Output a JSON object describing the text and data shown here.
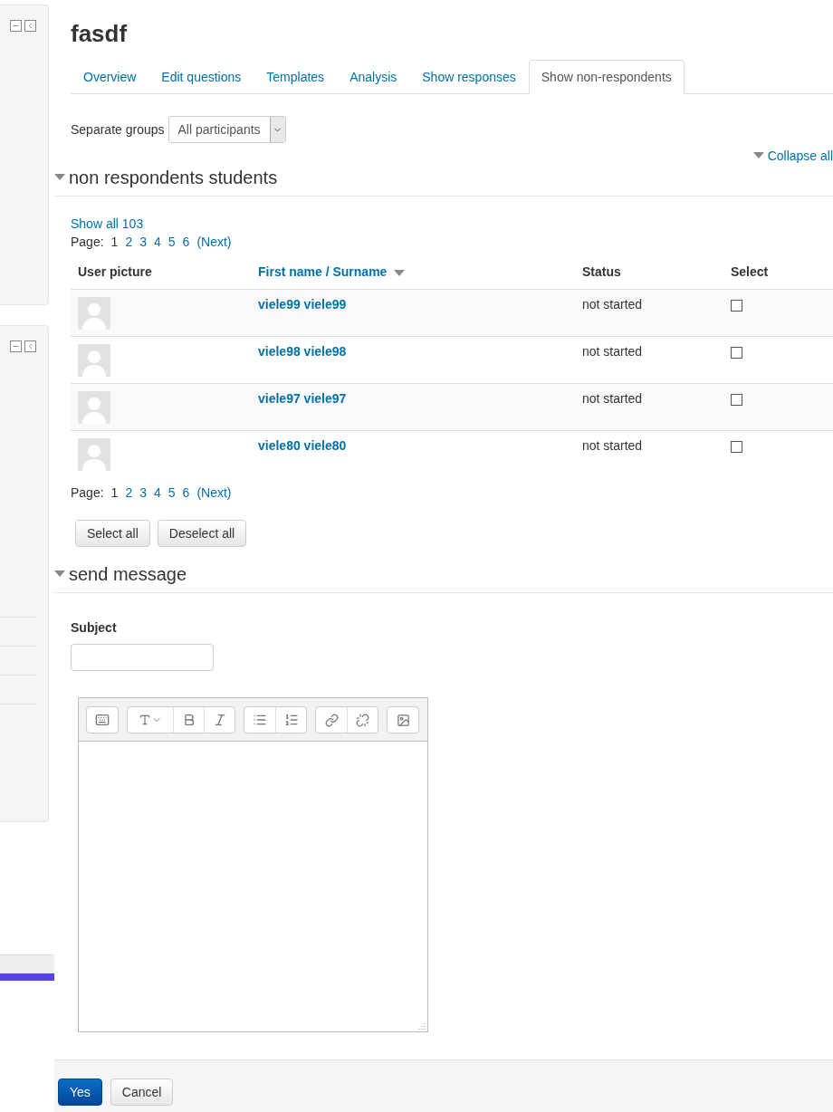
{
  "title": "fasdf",
  "tabs": [
    {
      "label": "Overview",
      "selected": false
    },
    {
      "label": "Edit questions",
      "selected": false
    },
    {
      "label": "Templates",
      "selected": false
    },
    {
      "label": "Analysis",
      "selected": false
    },
    {
      "label": "Show responses",
      "selected": false
    },
    {
      "label": "Show non-respondents",
      "selected": true
    }
  ],
  "group_filter": {
    "label": "Separate groups",
    "value": "All participants"
  },
  "collapse_all": "Collapse all",
  "sections": [
    {
      "title": "non respondents students",
      "expanded": true
    },
    {
      "title": "send message",
      "expanded": true
    }
  ],
  "show_all": "Show all 103",
  "pagination_top": {
    "label": "Page:",
    "pages": [
      {
        "label": "1",
        "selected": true
      },
      {
        "label": "2",
        "selected": false
      },
      {
        "label": "3",
        "selected": false
      },
      {
        "label": "4",
        "selected": false
      },
      {
        "label": "5",
        "selected": false
      },
      {
        "label": "6",
        "selected": false
      }
    ],
    "next": "(Next)"
  },
  "table": {
    "columns": [
      {
        "label": "User picture",
        "sortable": false
      },
      {
        "label": "First name / Surname",
        "sortable": true
      },
      {
        "label": "Status",
        "sortable": false
      },
      {
        "label": "Select",
        "sortable": false
      }
    ],
    "rows": [
      {
        "name": "viele99 viele99",
        "status": "not started",
        "checked": false
      },
      {
        "name": "viele98 viele98",
        "status": "not started",
        "checked": false
      },
      {
        "name": "viele97 viele97",
        "status": "not started",
        "checked": false
      },
      {
        "name": "viele80 viele80",
        "status": "not started",
        "checked": false
      }
    ]
  },
  "pagination_bottom": {
    "label": "Page:",
    "pages": [
      {
        "label": "1",
        "selected": true
      },
      {
        "label": "2",
        "selected": false
      },
      {
        "label": "3",
        "selected": false
      },
      {
        "label": "4",
        "selected": false
      },
      {
        "label": "5",
        "selected": false
      },
      {
        "label": "6",
        "selected": false
      }
    ],
    "next": "(Next)"
  },
  "selection_buttons": [
    "Select all",
    "Deselect all"
  ],
  "subject": {
    "label": "Subject"
  },
  "footer_buttons": [
    {
      "label": "Yes",
      "kind": "primary"
    },
    {
      "label": "Cancel",
      "kind": "default"
    }
  ]
}
